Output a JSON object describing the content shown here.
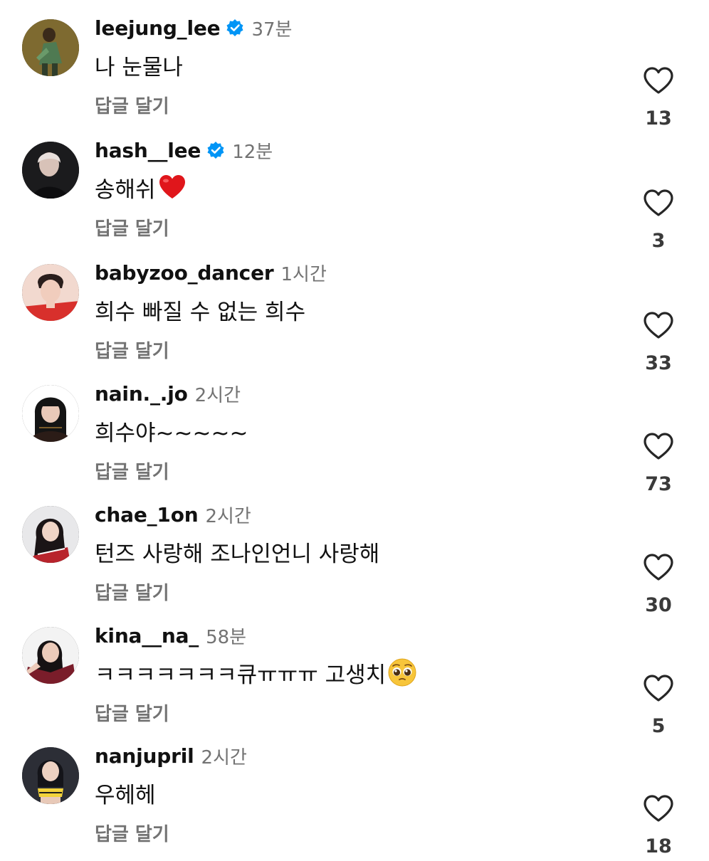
{
  "icons": {
    "verified": "verified-badge-icon",
    "like": "heart-outline-icon",
    "heart_emoji": "red-heart-emoji",
    "pleading_emoji": "pleading-face-emoji"
  },
  "colors": {
    "text": "#111111",
    "secondary": "#737373",
    "verified": "#0095f6",
    "heart_emoji": "#e0161b"
  },
  "reply_label": "답글 달기",
  "comments": [
    {
      "username": "leejung_lee",
      "verified": true,
      "time": "37분",
      "text": "나 눈물나",
      "likes": "13"
    },
    {
      "username": "hash__lee",
      "verified": true,
      "time": "12분",
      "text": "송해쉬",
      "emoji": "red-heart",
      "likes": "3"
    },
    {
      "username": "babyzoo_dancer",
      "verified": false,
      "time": "1시간",
      "text": "희수 빠질 수 없는 희수",
      "likes": "33"
    },
    {
      "username": "nain._.jo",
      "verified": false,
      "time": "2시간",
      "text": "희수야~~~~~",
      "likes": "73"
    },
    {
      "username": "chae_1on",
      "verified": false,
      "time": "2시간",
      "text": "턴즈 사랑해 조나인언니 사랑해",
      "likes": "30"
    },
    {
      "username": "kina__na_",
      "verified": false,
      "time": "58분",
      "text": "ㅋㅋㅋㅋㅋㅋㅋ큐ㅠㅠㅠ 고생치",
      "emoji": "pleading-face",
      "likes": "5"
    },
    {
      "username": "nanjupril",
      "verified": false,
      "time": "2시간",
      "text": "우헤헤",
      "likes": "18"
    }
  ]
}
